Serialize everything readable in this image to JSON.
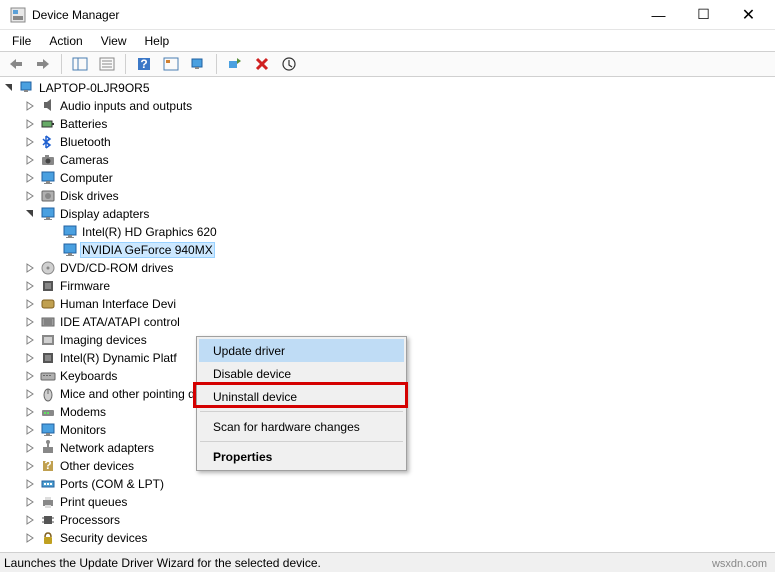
{
  "window": {
    "title": "Device Manager",
    "minimize": "—",
    "maximize": "☐",
    "close": "✕"
  },
  "menubar": [
    "File",
    "Action",
    "View",
    "Help"
  ],
  "tree": {
    "root": "LAPTOP-0LJR9OR5",
    "categories": [
      {
        "label": "Audio inputs and outputs",
        "icon": "audio",
        "state": "closed"
      },
      {
        "label": "Batteries",
        "icon": "battery",
        "state": "closed"
      },
      {
        "label": "Bluetooth",
        "icon": "bluetooth",
        "state": "closed"
      },
      {
        "label": "Cameras",
        "icon": "camera",
        "state": "closed"
      },
      {
        "label": "Computer",
        "icon": "monitor",
        "state": "closed"
      },
      {
        "label": "Disk drives",
        "icon": "disk",
        "state": "closed"
      },
      {
        "label": "Display adapters",
        "icon": "monitor",
        "state": "open",
        "children": [
          {
            "label": "Intel(R) HD Graphics 620",
            "icon": "monitor"
          },
          {
            "label": "NVIDIA GeForce 940MX",
            "icon": "monitor",
            "selected": true
          }
        ]
      },
      {
        "label": "DVD/CD-ROM drives",
        "icon": "dvd",
        "state": "closed"
      },
      {
        "label": "Firmware",
        "icon": "chip",
        "state": "closed"
      },
      {
        "label": "Human Interface Devi",
        "icon": "hid",
        "state": "closed"
      },
      {
        "label": "IDE ATA/ATAPI control",
        "icon": "ide",
        "state": "closed"
      },
      {
        "label": "Imaging devices",
        "icon": "imaging",
        "state": "closed"
      },
      {
        "label": "Intel(R) Dynamic Platf",
        "icon": "chip",
        "state": "closed"
      },
      {
        "label": "Keyboards",
        "icon": "keyboard",
        "state": "closed"
      },
      {
        "label": "Mice and other pointing devices",
        "icon": "mouse",
        "state": "closed"
      },
      {
        "label": "Modems",
        "icon": "modem",
        "state": "closed"
      },
      {
        "label": "Monitors",
        "icon": "monitor",
        "state": "closed"
      },
      {
        "label": "Network adapters",
        "icon": "network",
        "state": "closed"
      },
      {
        "label": "Other devices",
        "icon": "other",
        "state": "closed"
      },
      {
        "label": "Ports (COM & LPT)",
        "icon": "port",
        "state": "closed"
      },
      {
        "label": "Print queues",
        "icon": "printer",
        "state": "closed"
      },
      {
        "label": "Processors",
        "icon": "cpu",
        "state": "closed"
      },
      {
        "label": "Security devices",
        "icon": "security",
        "state": "closed"
      }
    ]
  },
  "context_menu": {
    "items": [
      {
        "label": "Update driver",
        "highlight": true
      },
      {
        "label": "Disable device"
      },
      {
        "label": "Uninstall device",
        "boxed": true
      },
      {
        "sep": true
      },
      {
        "label": "Scan for hardware changes"
      },
      {
        "sep": true
      },
      {
        "label": "Properties",
        "bold": true
      }
    ]
  },
  "statusbar": "Launches the Update Driver Wizard for the selected device.",
  "watermark": "wsxdn.com"
}
